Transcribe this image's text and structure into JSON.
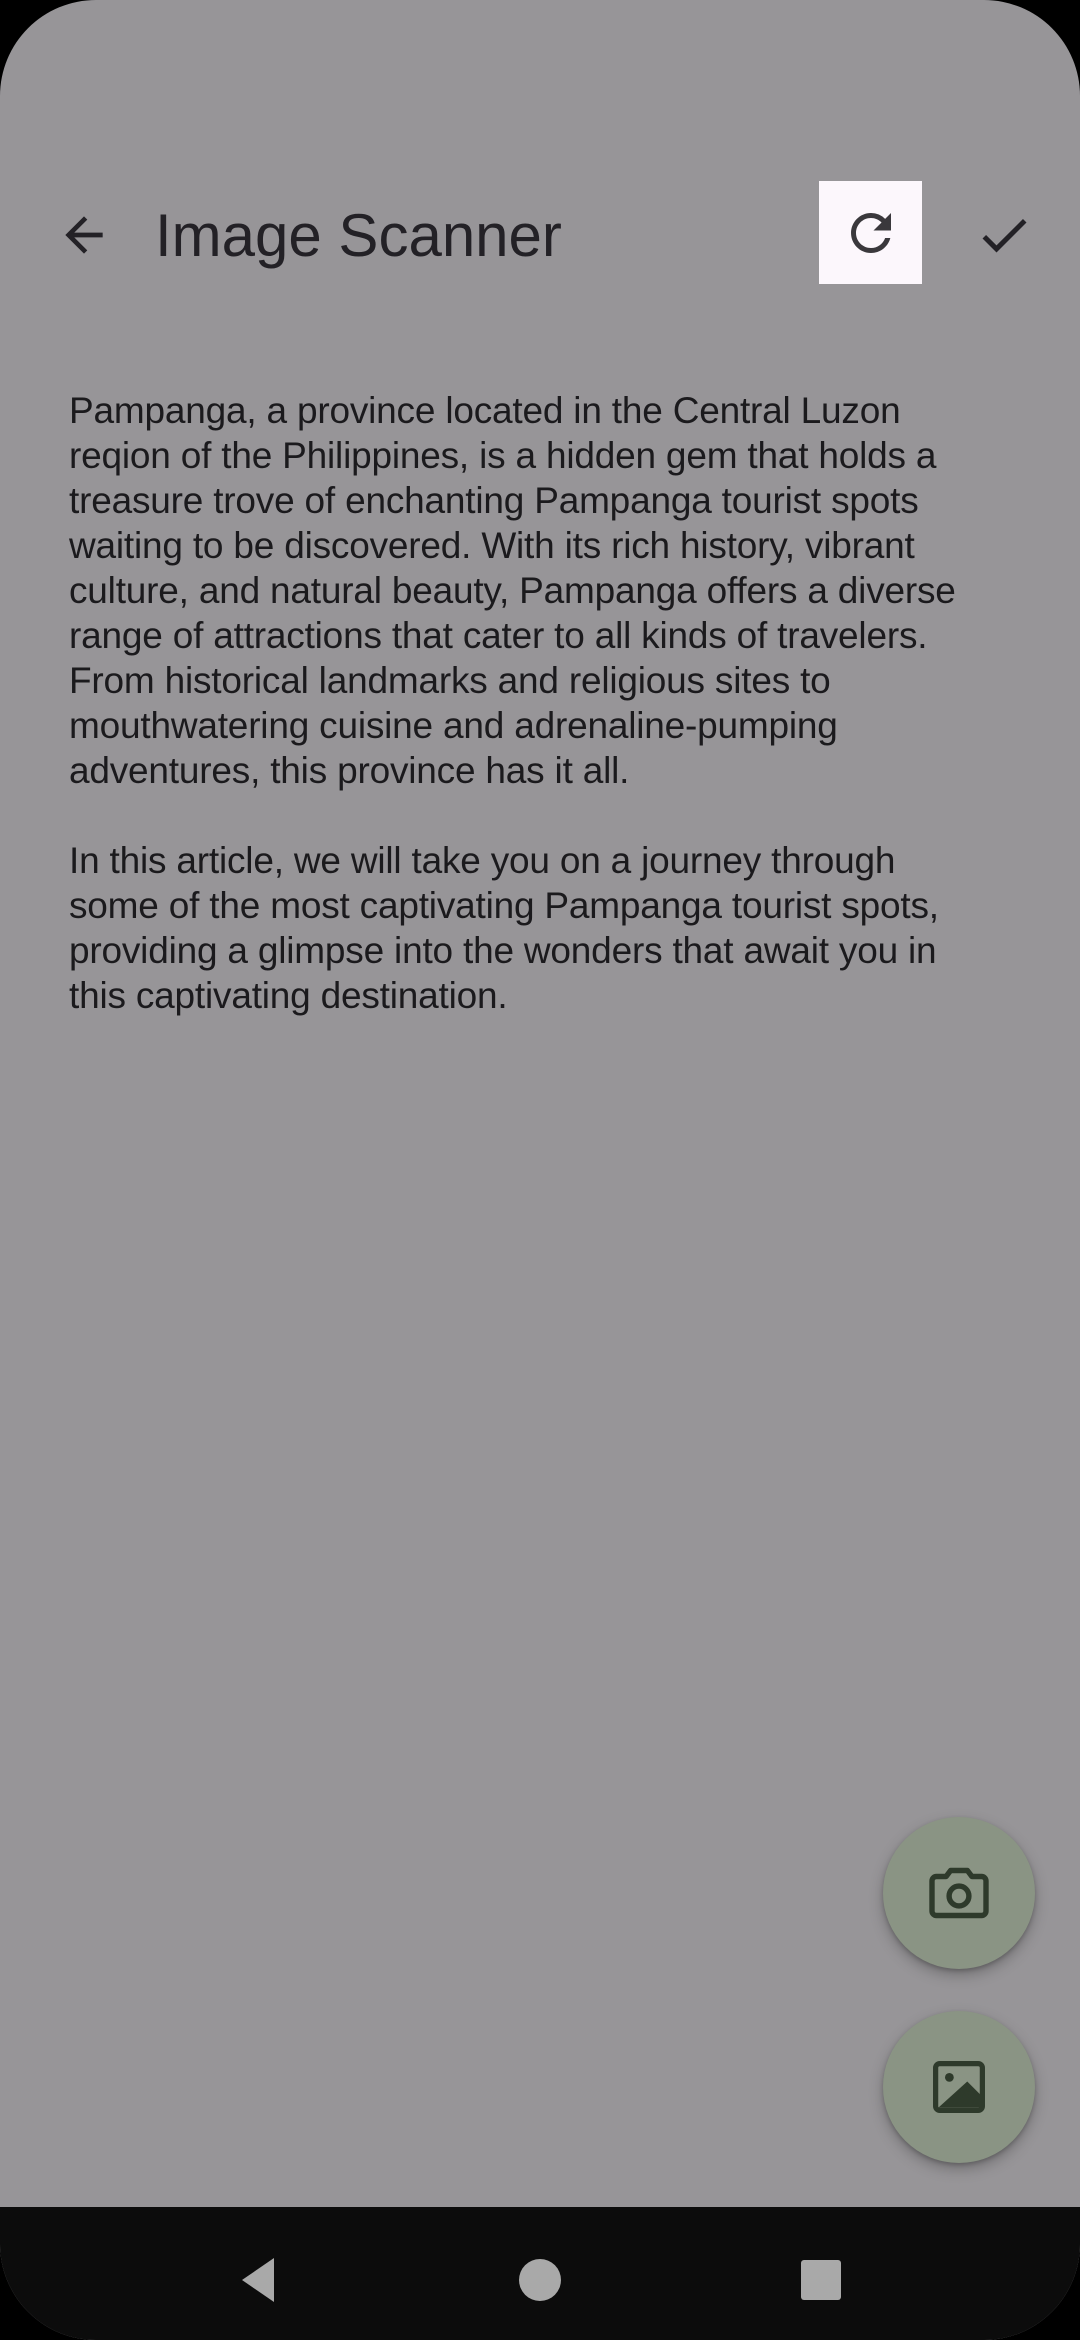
{
  "app": {
    "title": "Image Scanner"
  },
  "toolbar": {
    "back_icon": "arrow-back-icon",
    "refresh_icon": "refresh-icon",
    "confirm_icon": "check-icon"
  },
  "scanned_text": {
    "paragraphs": [
      "Pampanga, a province located in the Central Luzon\nreqion of the Philippines, is a hidden gem that holds a\ntreasure trove of enchanting Pampanga tourist spots\nwaiting to be discovered. With its rich history, vibrant\nculture, and natural beauty, Pampanga offers a diverse\nrange of attractions that cater to all kinds of travelers.\nFrom historical landmarks and religious sites to\nmouthwatering cuisine and adrenaline-pumping\nadventures, this province has it all.",
      "In this article, we will take you on a journey through\nsome of the most captivating Pampanga tourist spots,\nproviding a glimpse into the wonders that await you in\nthis captivating destination."
    ]
  },
  "fabs": {
    "camera_icon": "camera-icon",
    "gallery_icon": "image-icon"
  },
  "navigation": {
    "back_icon": "nav-back-icon",
    "home_icon": "nav-home-icon",
    "recents_icon": "nav-recents-icon"
  },
  "colors": {
    "scrim_background": "#979598",
    "highlight": "#fcf7fc",
    "fab": "#8a9484",
    "nav_bar": "#0c0c0c"
  }
}
